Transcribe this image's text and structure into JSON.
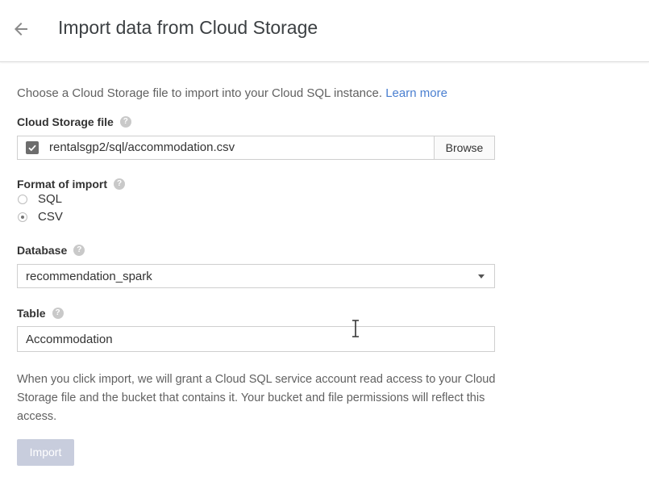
{
  "header": {
    "back_icon": "arrow-back-icon",
    "title": "Import data from Cloud Storage"
  },
  "intro": {
    "text": "Choose a Cloud Storage file to import into your Cloud SQL instance.",
    "link": "Learn more"
  },
  "cloud_storage_file": {
    "label": "Cloud Storage file",
    "value": "rentalsgp2/sql/accommodation.csv",
    "browse_label": "Browse"
  },
  "format": {
    "label": "Format of import",
    "options": [
      {
        "label": "SQL",
        "selected": false
      },
      {
        "label": "CSV",
        "selected": true
      }
    ]
  },
  "database": {
    "label": "Database",
    "value": "recommendation_spark"
  },
  "table": {
    "label": "Table",
    "value": "Accommodation"
  },
  "note": "When you click import, we will grant a Cloud SQL service account read access to your Cloud Storage file and the bucket that contains it. Your bucket and file permissions will reflect this access.",
  "import_button": "Import",
  "colors": {
    "link": "#4a7fd0",
    "import_button_disabled": "#c8cddd"
  }
}
